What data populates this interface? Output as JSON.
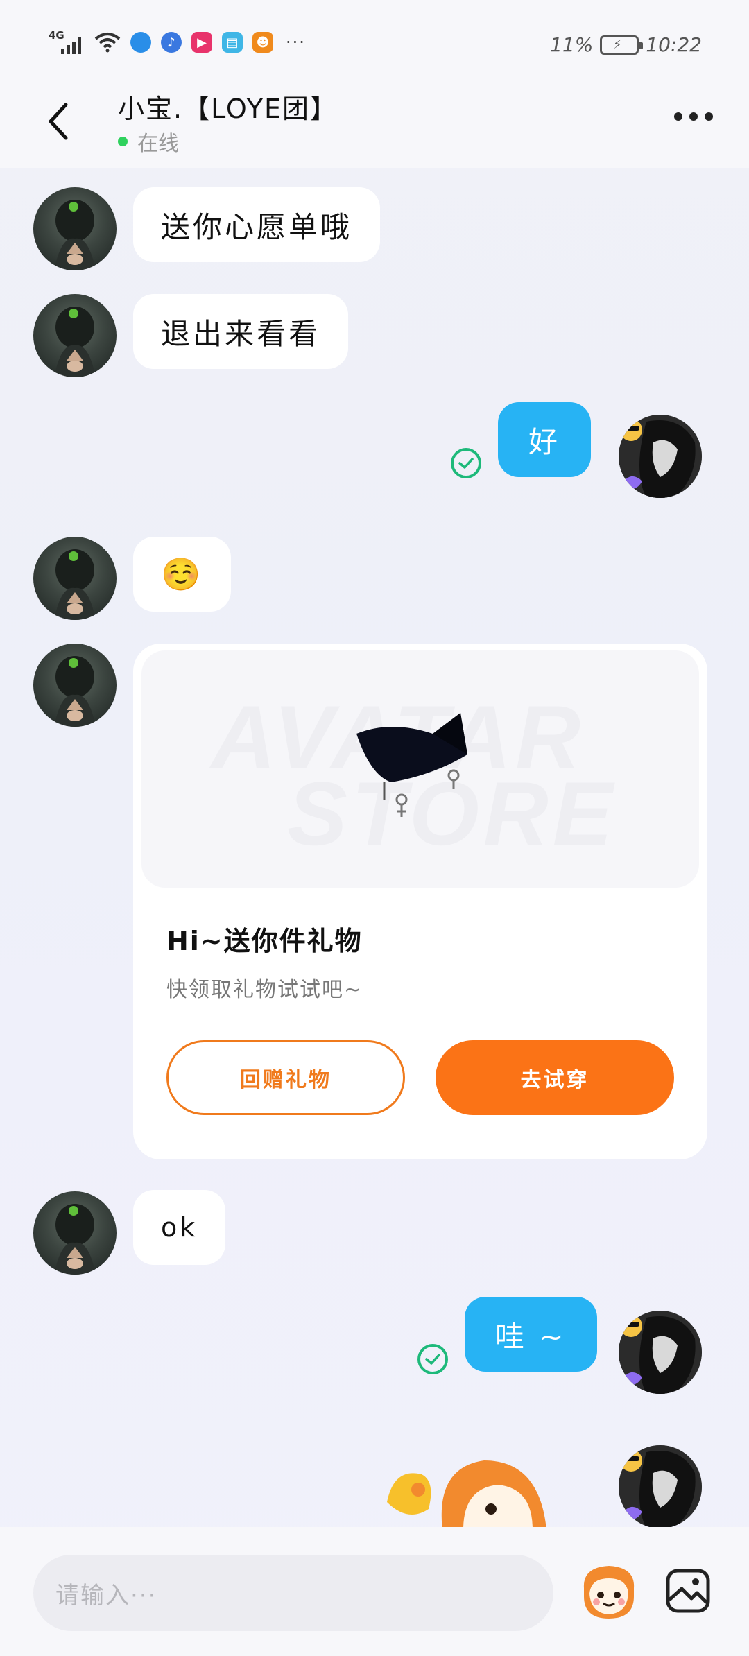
{
  "status_bar": {
    "network": "4G",
    "battery_percent": "11%",
    "time": "10:22",
    "more": "···"
  },
  "header": {
    "title": "小宝.【LOYE团】",
    "status": "在线"
  },
  "messages": [
    {
      "side": "left",
      "text": "送你心愿单哦"
    },
    {
      "side": "left",
      "text": "退出来看看"
    },
    {
      "side": "right",
      "text": "好",
      "read": true
    },
    {
      "side": "left",
      "text": "☺️"
    },
    {
      "side": "left",
      "type": "gift_card"
    },
    {
      "side": "left",
      "text": "ok"
    },
    {
      "side": "right",
      "text": "哇 ~",
      "read": true
    },
    {
      "side": "right",
      "type": "sticker"
    }
  ],
  "gift_card": {
    "watermark_line1": "AVATAR",
    "watermark_line2": "STORE",
    "title": "Hi~送你件礼物",
    "subtitle": "快领取礼物试试吧~",
    "return_gift_label": "回赠礼物",
    "try_on_label": "去试穿"
  },
  "input_bar": {
    "placeholder": "请输入···"
  },
  "colors": {
    "accent_blue": "#27b3f4",
    "accent_orange": "#fb7316",
    "online_green": "#2fd15d",
    "read_check": "#1db97a"
  }
}
